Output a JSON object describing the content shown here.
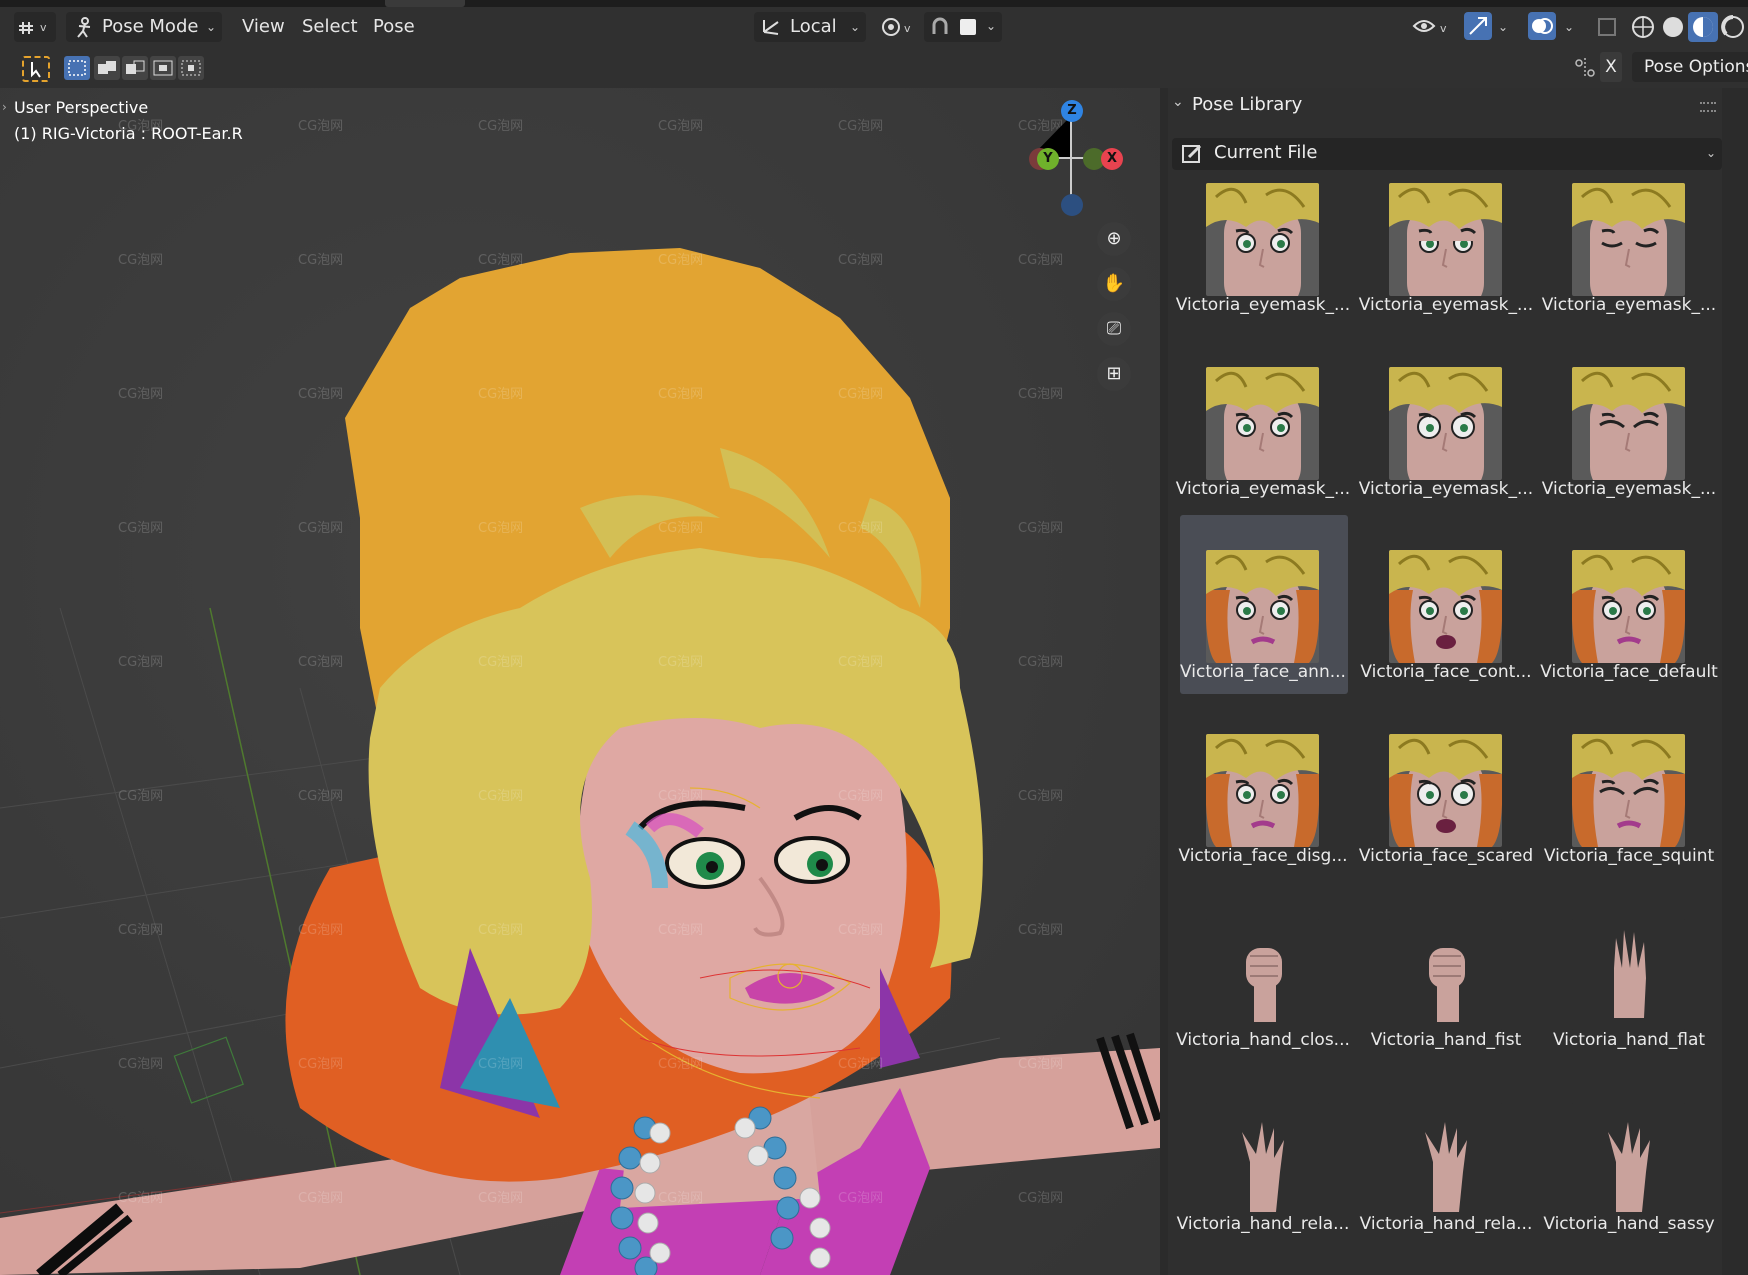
{
  "header": {
    "editor_icon": "armature-editor-icon",
    "mode": {
      "label": "Pose Mode",
      "icon": "pose-mode-icon"
    },
    "menus": [
      "View",
      "Select",
      "Pose"
    ],
    "transform_orientation": "Local",
    "options_label": "Pose Options",
    "x_mirror_label": "X"
  },
  "viewport": {
    "perspective": "User Perspective",
    "active": "(1) RIG-Victoria : ROOT-Ear.R",
    "gizmo": {
      "z": "Z",
      "y": "Y",
      "x": "X"
    },
    "watermark": "CG泡网"
  },
  "pose_library": {
    "title": "Pose Library",
    "source": "Current File",
    "items": [
      {
        "label": "Victoria_eyemask_...",
        "type": "eyemask",
        "expr": "angry"
      },
      {
        "label": "Victoria_eyemask_...",
        "type": "eyemask",
        "expr": "lidded"
      },
      {
        "label": "Victoria_eyemask_...",
        "type": "eyemask",
        "expr": "closed"
      },
      {
        "label": "Victoria_eyemask_...",
        "type": "eyemask",
        "expr": "open"
      },
      {
        "label": "Victoria_eyemask_...",
        "type": "eyemask",
        "expr": "surprised"
      },
      {
        "label": "Victoria_eyemask_...",
        "type": "eyemask",
        "expr": "squint"
      },
      {
        "label": "Victoria_face_ann...",
        "type": "face",
        "expr": "annoyed",
        "selected": true
      },
      {
        "label": "Victoria_face_cont...",
        "type": "face",
        "expr": "content"
      },
      {
        "label": "Victoria_face_default",
        "type": "face",
        "expr": "default"
      },
      {
        "label": "Victoria_face_disg...",
        "type": "face",
        "expr": "disgust"
      },
      {
        "label": "Victoria_face_scared",
        "type": "face",
        "expr": "scared"
      },
      {
        "label": "Victoria_face_squint",
        "type": "face",
        "expr": "squint"
      },
      {
        "label": "Victoria_hand_clos...",
        "type": "hand",
        "expr": "closed"
      },
      {
        "label": "Victoria_hand_fist",
        "type": "hand",
        "expr": "fist"
      },
      {
        "label": "Victoria_hand_flat",
        "type": "hand",
        "expr": "flat"
      },
      {
        "label": "Victoria_hand_rela...",
        "type": "hand",
        "expr": "relaxed1"
      },
      {
        "label": "Victoria_hand_rela...",
        "type": "hand",
        "expr": "relaxed2"
      },
      {
        "label": "Victoria_hand_sassy",
        "type": "hand",
        "expr": "sassy"
      }
    ]
  },
  "colors": {
    "accent": "#4772b3",
    "x_axis": "#e8434f",
    "y_axis": "#6fb12b",
    "z_axis": "#2f84e3",
    "hair": "#d8c45a",
    "hair_back": "#e2a432"
  }
}
